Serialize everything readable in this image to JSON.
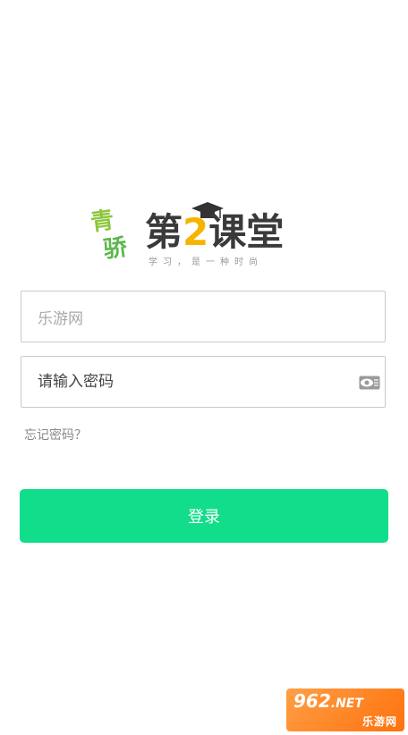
{
  "logo": {
    "side_text_top": "青",
    "side_text_bottom": "骄",
    "brand_prefix": "第",
    "brand_number": "2",
    "brand_suffix": "课堂",
    "slogan": "学习，是一种时尚"
  },
  "form": {
    "username_value": "乐游网",
    "password_placeholder": "请输入密码",
    "forgot_label": "忘记密码？",
    "login_label": "登录"
  },
  "watermark": {
    "top": "962",
    "net": ".NET",
    "bottom": "乐游网"
  },
  "colors": {
    "accent": "#12dd8a",
    "logo_green": "#8cc63f",
    "logo_yellow": "#f5b400"
  }
}
